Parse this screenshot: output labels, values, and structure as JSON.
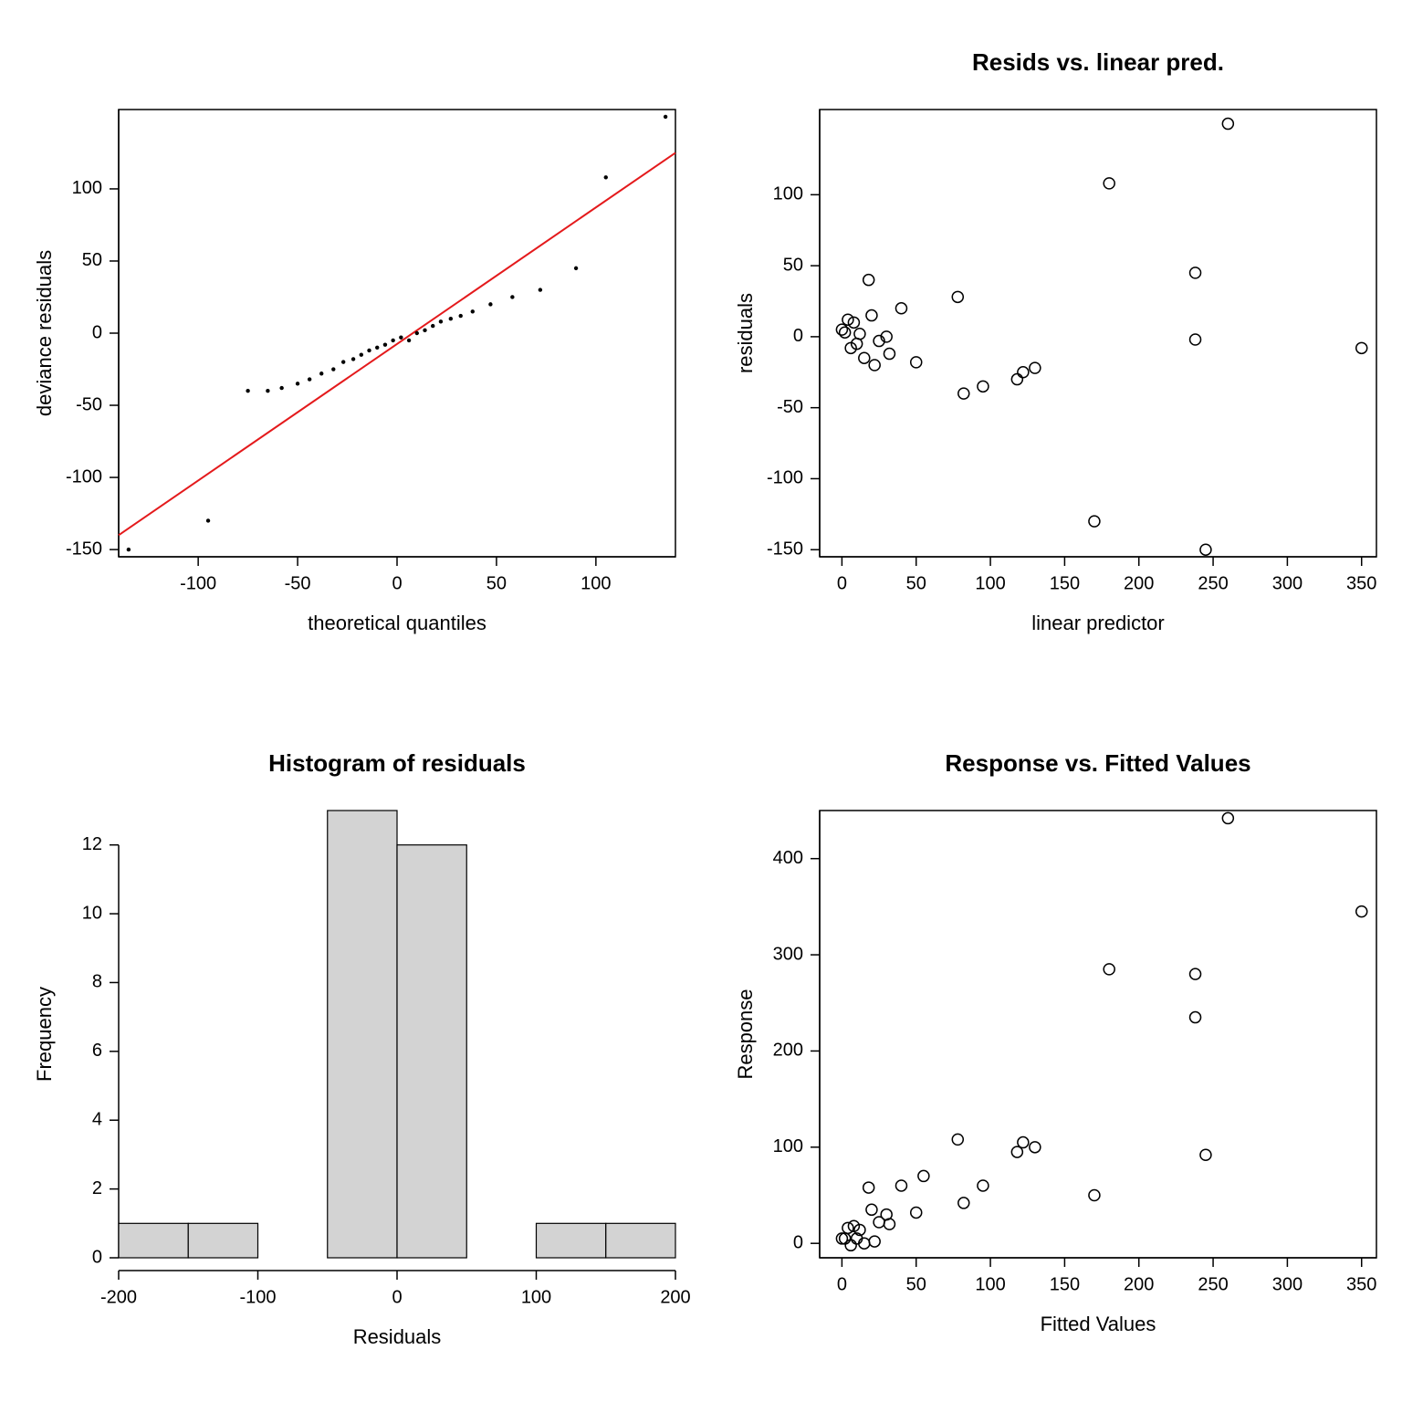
{
  "chart_data": [
    {
      "id": "qq",
      "type": "scatter",
      "title": "",
      "xlabel": "theoretical quantiles",
      "ylabel": "deviance residuals",
      "xlim": [
        -140,
        140
      ],
      "ylim": [
        -155,
        155
      ],
      "x_ticks": [
        -100,
        -50,
        0,
        50,
        100
      ],
      "y_ticks": [
        -150,
        -100,
        -50,
        0,
        50,
        100
      ],
      "line": {
        "x1": -140,
        "y1": -140,
        "x2": 140,
        "y2": 125
      },
      "points": [
        [
          -135,
          -150
        ],
        [
          -95,
          -130
        ],
        [
          -75,
          -40
        ],
        [
          -65,
          -40
        ],
        [
          -58,
          -38
        ],
        [
          -50,
          -35
        ],
        [
          -44,
          -32
        ],
        [
          -38,
          -28
        ],
        [
          -32,
          -25
        ],
        [
          -27,
          -20
        ],
        [
          -22,
          -18
        ],
        [
          -18,
          -15
        ],
        [
          -14,
          -12
        ],
        [
          -10,
          -10
        ],
        [
          -6,
          -8
        ],
        [
          -2,
          -5
        ],
        [
          2,
          -3
        ],
        [
          6,
          -5
        ],
        [
          10,
          0
        ],
        [
          14,
          2
        ],
        [
          18,
          5
        ],
        [
          22,
          8
        ],
        [
          27,
          10
        ],
        [
          32,
          12
        ],
        [
          38,
          15
        ],
        [
          47,
          20
        ],
        [
          58,
          25
        ],
        [
          72,
          30
        ],
        [
          90,
          45
        ],
        [
          105,
          108
        ],
        [
          135,
          150
        ]
      ]
    },
    {
      "id": "resid_vs_pred",
      "type": "scatter",
      "title": "Resids vs. linear pred.",
      "xlabel": "linear predictor",
      "ylabel": "residuals",
      "xlim": [
        -15,
        360
      ],
      "ylim": [
        -155,
        160
      ],
      "x_ticks": [
        0,
        50,
        100,
        150,
        200,
        250,
        300,
        350
      ],
      "y_ticks": [
        -150,
        -100,
        -50,
        0,
        50,
        100
      ],
      "points": [
        [
          0,
          5
        ],
        [
          2,
          3
        ],
        [
          4,
          12
        ],
        [
          6,
          -8
        ],
        [
          8,
          10
        ],
        [
          10,
          -5
        ],
        [
          12,
          2
        ],
        [
          15,
          -15
        ],
        [
          18,
          40
        ],
        [
          20,
          15
        ],
        [
          22,
          -20
        ],
        [
          25,
          -3
        ],
        [
          30,
          0
        ],
        [
          32,
          -12
        ],
        [
          40,
          20
        ],
        [
          50,
          -18
        ],
        [
          78,
          28
        ],
        [
          82,
          -40
        ],
        [
          95,
          -35
        ],
        [
          118,
          -30
        ],
        [
          122,
          -25
        ],
        [
          130,
          -22
        ],
        [
          170,
          -130
        ],
        [
          180,
          108
        ],
        [
          238,
          45
        ],
        [
          238,
          -2
        ],
        [
          245,
          -150
        ],
        [
          260,
          150
        ],
        [
          350,
          -8
        ]
      ]
    },
    {
      "id": "hist",
      "type": "bar",
      "title": "Histogram of residuals",
      "xlabel": "Residuals",
      "ylabel": "Frequency",
      "xlim": [
        -200,
        200
      ],
      "ylim": [
        0,
        13
      ],
      "x_ticks": [
        -200,
        -100,
        0,
        100,
        200
      ],
      "y_ticks": [
        0,
        2,
        4,
        6,
        8,
        10,
        12
      ],
      "bin_width": 50,
      "bins": [
        {
          "x0": -200,
          "count": 1
        },
        {
          "x0": -150,
          "count": 1
        },
        {
          "x0": -100,
          "count": 0
        },
        {
          "x0": -50,
          "count": 13
        },
        {
          "x0": 0,
          "count": 12
        },
        {
          "x0": 50,
          "count": 0
        },
        {
          "x0": 100,
          "count": 1
        },
        {
          "x0": 150,
          "count": 1
        }
      ]
    },
    {
      "id": "resp_vs_fit",
      "type": "scatter",
      "title": "Response vs. Fitted Values",
      "xlabel": "Fitted Values",
      "ylabel": "Response",
      "xlim": [
        -15,
        360
      ],
      "ylim": [
        -15,
        450
      ],
      "x_ticks": [
        0,
        50,
        100,
        150,
        200,
        250,
        300,
        350
      ],
      "y_ticks": [
        0,
        100,
        200,
        300,
        400
      ],
      "points": [
        [
          0,
          5
        ],
        [
          2,
          5
        ],
        [
          4,
          16
        ],
        [
          6,
          -2
        ],
        [
          8,
          18
        ],
        [
          10,
          5
        ],
        [
          12,
          14
        ],
        [
          15,
          0
        ],
        [
          18,
          58
        ],
        [
          20,
          35
        ],
        [
          22,
          2
        ],
        [
          25,
          22
        ],
        [
          30,
          30
        ],
        [
          32,
          20
        ],
        [
          40,
          60
        ],
        [
          50,
          32
        ],
        [
          55,
          70
        ],
        [
          78,
          108
        ],
        [
          82,
          42
        ],
        [
          95,
          60
        ],
        [
          118,
          95
        ],
        [
          122,
          105
        ],
        [
          130,
          100
        ],
        [
          170,
          50
        ],
        [
          180,
          285
        ],
        [
          238,
          280
        ],
        [
          238,
          235
        ],
        [
          245,
          92
        ],
        [
          260,
          442
        ],
        [
          350,
          345
        ]
      ]
    }
  ]
}
